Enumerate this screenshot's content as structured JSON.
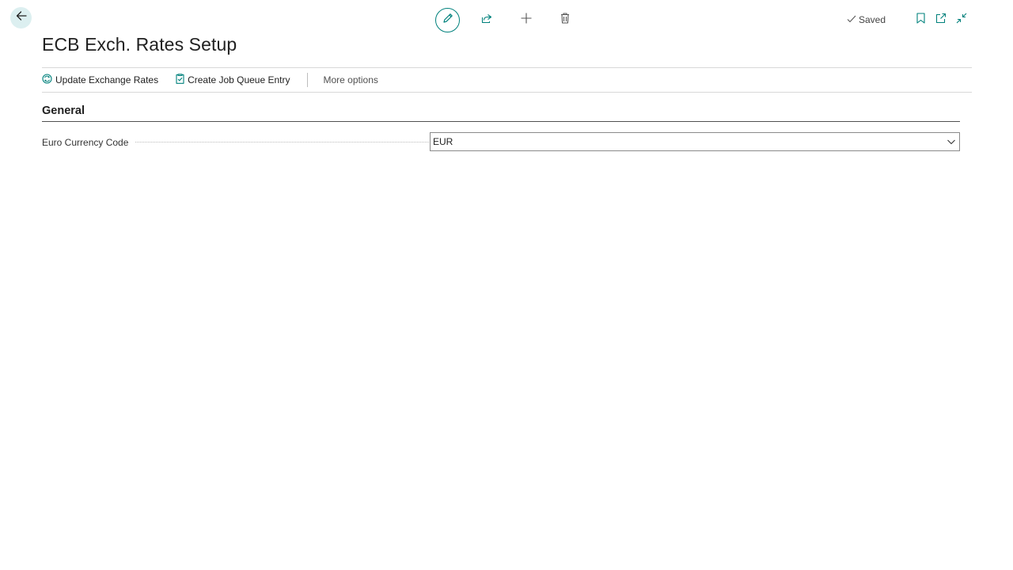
{
  "page": {
    "title": "ECB Exch. Rates Setup"
  },
  "header": {
    "status": "Saved"
  },
  "actions": {
    "update_exchange_rates": "Update Exchange Rates",
    "create_job_queue_entry": "Create Job Queue Entry",
    "more_options": "More options"
  },
  "section": {
    "title": "General",
    "fields": [
      {
        "label": "Euro Currency Code",
        "value": "EUR"
      }
    ]
  },
  "icons": {
    "back": "arrow-left-icon",
    "edit": "pencil-icon",
    "share": "share-icon",
    "new": "plus-icon",
    "delete": "trash-icon",
    "saved": "checkmark-icon",
    "bookmark": "bookmark-icon",
    "open_new_window": "open-in-new-icon",
    "collapse": "collapse-icon",
    "update_rates": "exchange-rates-icon",
    "job_queue": "clipboard-check-icon",
    "dropdown": "chevron-down-icon"
  },
  "colors": {
    "accent": "#00817c",
    "back_button_bg": "#dceff0"
  }
}
